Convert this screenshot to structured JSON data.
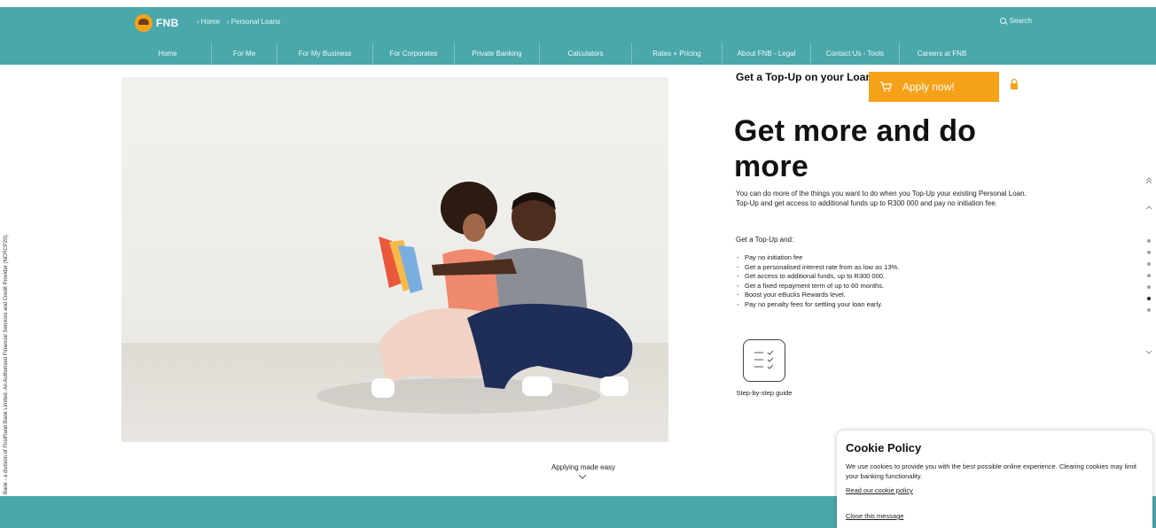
{
  "header": {
    "logo_text": "FNB",
    "breadcrumbs": [
      "Home",
      "Personal Loans"
    ],
    "search_label": "Search"
  },
  "nav": {
    "items": [
      "Home",
      "For Me",
      "For My Business",
      "For Corporates",
      "Private Banking",
      "Calculators",
      "Rates + Pricing",
      "About FNB - Legal",
      "Contact Us - Tools",
      "Careers at FNB"
    ]
  },
  "side_text": "First National Bank - a division of FirstRand Bank Limited. An Authorised Financial Services and Credit Provider (NCRCP20).",
  "hero": {
    "caption": "Applying made easy"
  },
  "product": {
    "topup_title": "Get a Top-Up on your Loan",
    "apply_label": "Apply now!",
    "headline": "Get more and do more",
    "intro": "You can do more of the things you want to do when you Top-Up your existing Personal Loan. Top-Up and get access to additional funds up to R300 000 and pay no initiation fee.",
    "get_topup": "Get a Top-Up and:",
    "bullets": [
      "Pay no initiation fee",
      "Get a personalised interest rate from as low as 13%.",
      "Get access to additional funds, up to R300 000.",
      "Get a fixed repayment term of up to 60 months.",
      "Boost your eBucks Rewards level.",
      "Pay no penalty fees for settling your loan early."
    ],
    "guide_label": "Step-by-step guide"
  },
  "cookie": {
    "title": "Cookie Policy",
    "text": "We use cookies to provide you with the best possible online experience. Clearing cookies may limit your banking functionality.",
    "link": "Read our cookie policy",
    "close": "Close this message"
  },
  "colors": {
    "brand_teal": "#4aa8ab",
    "accent_orange": "#f6a11a"
  }
}
